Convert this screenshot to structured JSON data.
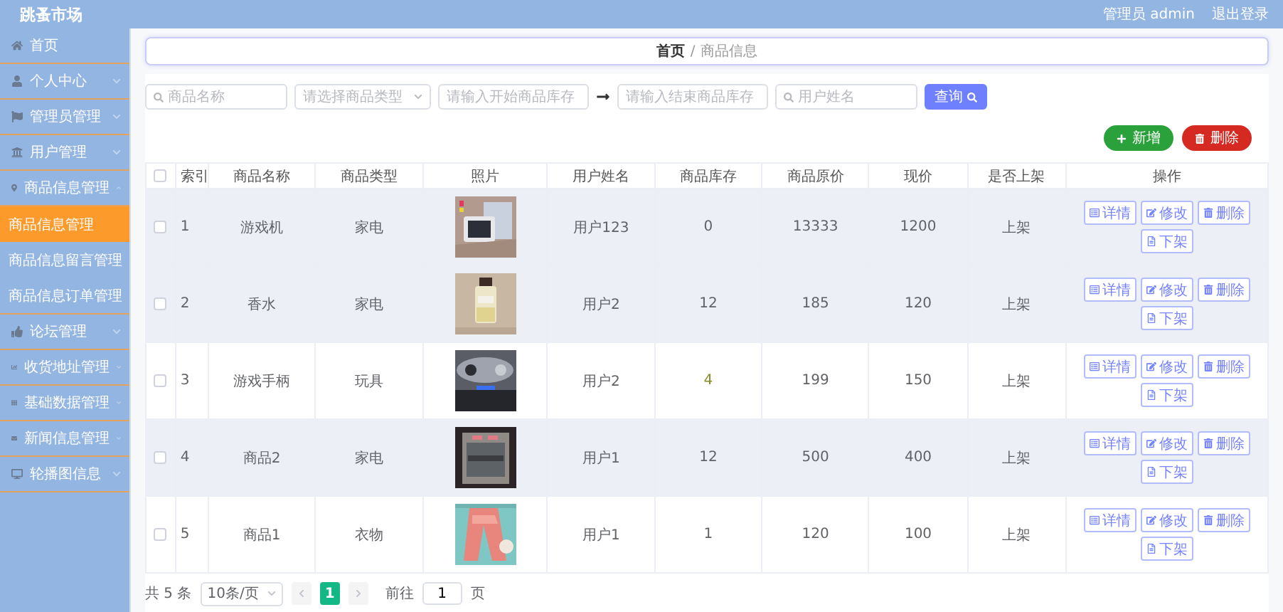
{
  "header": {
    "title": "跳蚤市场",
    "user": "管理员 admin",
    "logout": "退出登录"
  },
  "sidebar": {
    "items": [
      {
        "label": "首页",
        "selected": false
      },
      {
        "label": "个人中心",
        "selected": false,
        "expanded": false
      },
      {
        "label": "管理员管理",
        "selected": false,
        "expanded": false
      },
      {
        "label": "用户管理",
        "selected": false,
        "expanded": false
      },
      {
        "label": "商品信息管理",
        "selected": false,
        "expanded": true,
        "children": [
          {
            "label": "商品信息管理",
            "selected": true
          },
          {
            "label": "商品信息留言管理",
            "selected": false
          },
          {
            "label": "商品信息订单管理",
            "selected": false
          }
        ]
      },
      {
        "label": "论坛管理",
        "selected": false,
        "expanded": false
      },
      {
        "label": "收货地址管理",
        "selected": false,
        "expanded": false
      },
      {
        "label": "基础数据管理",
        "selected": false,
        "expanded": false
      },
      {
        "label": "新闻信息管理",
        "selected": false,
        "expanded": false
      },
      {
        "label": "轮播图信息",
        "selected": false,
        "expanded": false
      }
    ]
  },
  "breadcrumb": {
    "items": [
      "首页",
      "商品信息"
    ],
    "separator": "/"
  },
  "search": {
    "fields": [
      {
        "kind": "search",
        "placeholder": "商品名称"
      },
      {
        "kind": "select",
        "placeholder": "请选择商品类型"
      },
      {
        "kind": "range_start",
        "placeholder": "请输入开始商品库存"
      },
      {
        "kind": "text",
        "placeholder": "请输入结束商品库存"
      },
      {
        "kind": "search",
        "placeholder": "用户姓名"
      }
    ],
    "query_button": "查询"
  },
  "actions": {
    "add": "新增",
    "delete": "删除"
  },
  "table": {
    "select_all_checked": false,
    "columns": [
      "索引",
      "商品名称",
      "商品类型",
      "照片",
      "用户姓名",
      "商品库存",
      "商品原价",
      "现价",
      "是否上架",
      "操作"
    ],
    "rows": [
      {
        "checked": false,
        "highlighted": true,
        "index": "1",
        "name": "游戏机",
        "type": "家电",
        "photo": {
          "kind": "picture"
        },
        "user": "用户123",
        "stock": "0",
        "price": "13333",
        "current": "1200",
        "listed": "上架",
        "actions": [
          "详情",
          "修改",
          "删除",
          "下架"
        ]
      },
      {
        "checked": false,
        "highlighted": true,
        "index": "2",
        "name": "香水",
        "type": "家电",
        "photo": {
          "kind": "picture"
        },
        "user": "用户2",
        "stock": "12",
        "price": "185",
        "current": "120",
        "listed": "上架",
        "actions": [
          "详情",
          "修改",
          "删除",
          "下架"
        ]
      },
      {
        "checked": false,
        "highlighted": false,
        "index": "3",
        "name": "游戏手柄",
        "type": "玩具",
        "photo": {
          "kind": "picture"
        },
        "user": "用户2",
        "stock": "4",
        "price": "199",
        "current": "150",
        "listed": "上架",
        "actions": [
          "详情",
          "修改",
          "删除",
          "下架"
        ]
      },
      {
        "checked": false,
        "highlighted": true,
        "index": "4",
        "name": "商品2",
        "type": "家电",
        "photo": {
          "kind": "picture"
        },
        "user": "用户1",
        "stock": "12",
        "price": "500",
        "current": "400",
        "listed": "上架",
        "actions": [
          "详情",
          "修改",
          "删除",
          "下架"
        ]
      },
      {
        "checked": false,
        "highlighted": false,
        "index": "5",
        "name": "商品1",
        "type": "衣物",
        "photo": {
          "kind": "picture"
        },
        "user": "用户1",
        "stock": "1",
        "price": "120",
        "current": "100",
        "listed": "上架",
        "actions": [
          "详情",
          "修改",
          "删除",
          "下架"
        ]
      }
    ]
  },
  "pagination": {
    "total": "共 5 条",
    "page_size": "10条/页",
    "pages": [
      {
        "label": "1",
        "selected": true
      }
    ],
    "goto": "前往",
    "goto_value": "1",
    "goto_suffix": "页"
  }
}
